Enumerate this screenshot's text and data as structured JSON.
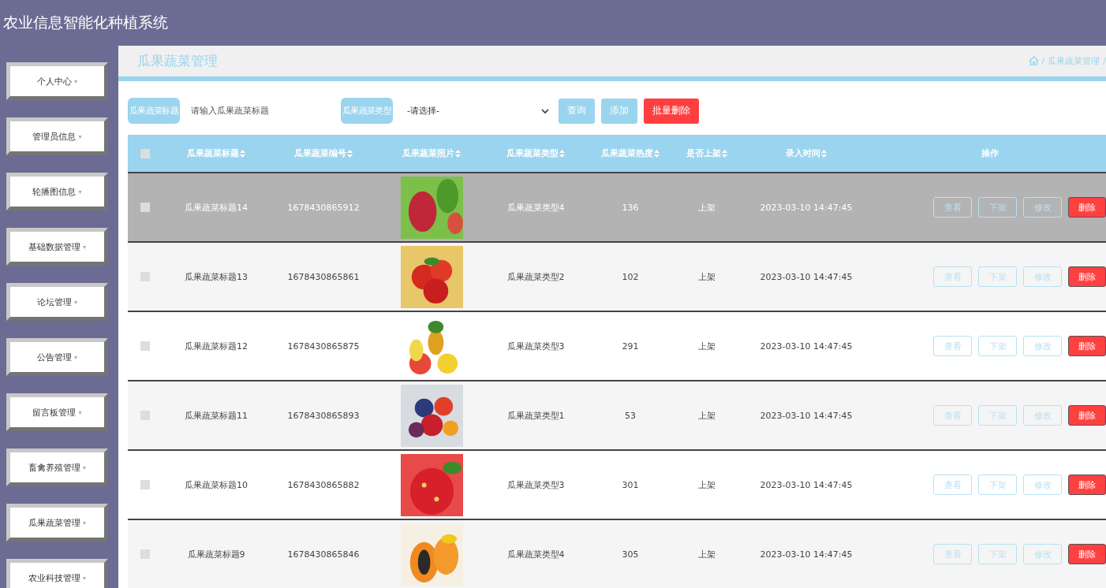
{
  "app_title": "农业信息智能化种植系统",
  "sidebar": {
    "items": [
      {
        "label": "个人中心",
        "caret": "▾"
      },
      {
        "label": "管理员信息",
        "caret": "▾"
      },
      {
        "label": "轮播图信息",
        "caret": "▾"
      },
      {
        "label": "基础数据管理",
        "caret": "▾"
      },
      {
        "label": "论坛管理",
        "caret": "▾"
      },
      {
        "label": "公告管理",
        "caret": "▾"
      },
      {
        "label": "留言板管理",
        "caret": "▾"
      },
      {
        "label": "畜禽养殖管理",
        "caret": "▾"
      },
      {
        "label": "瓜果蔬菜管理",
        "caret": "▾"
      },
      {
        "label": "农业科技管理",
        "caret": "▾"
      }
    ]
  },
  "page_title": "瓜果蔬菜管理",
  "breadcrumb": [
    "/",
    "瓜果蔬菜管理",
    "/"
  ],
  "filters": {
    "title_label": "瓜果蔬菜标题",
    "title_placeholder": "请输入瓜果蔬菜标题",
    "type_label": "瓜果蔬菜类型",
    "type_value": "-请选择-"
  },
  "actions": [
    {
      "label": "查询",
      "kind": "primary"
    },
    {
      "label": "添加",
      "kind": "primary"
    },
    {
      "label": "批量删除",
      "kind": "danger"
    }
  ],
  "table": {
    "columns": [
      {
        "label": "瓜果蔬菜标题",
        "sortable": true
      },
      {
        "label": "瓜果蔬菜编号",
        "sortable": true
      },
      {
        "label": "瓜果蔬菜照片",
        "sortable": true
      },
      {
        "label": "瓜果蔬菜类型",
        "sortable": true
      },
      {
        "label": "瓜果蔬菜热度",
        "sortable": true
      },
      {
        "label": "是否上架",
        "sortable": true
      },
      {
        "label": "录入时间",
        "sortable": true
      },
      {
        "label": "操作",
        "sortable": false
      }
    ],
    "all_checked": false,
    "rows": [
      {
        "checked": false,
        "highlighted": true,
        "title": "瓜果蔬菜标题14",
        "number": "1678430865912",
        "type": "瓜果蔬菜类型4",
        "heat": "136",
        "on_shelf": "上架",
        "time": "2023-03-10 14:47:45",
        "buttons": [
          "查看",
          "下架",
          "修改",
          "删除"
        ]
      },
      {
        "checked": false,
        "highlighted": false,
        "title": "瓜果蔬菜标题13",
        "number": "1678430865861",
        "type": "瓜果蔬菜类型2",
        "heat": "102",
        "on_shelf": "上架",
        "time": "2023-03-10 14:47:45",
        "buttons": [
          "查看",
          "下架",
          "修改",
          "删除"
        ]
      },
      {
        "checked": false,
        "highlighted": false,
        "title": "瓜果蔬菜标题12",
        "number": "1678430865875",
        "type": "瓜果蔬菜类型3",
        "heat": "291",
        "on_shelf": "上架",
        "time": "2023-03-10 14:47:45",
        "buttons": [
          "查看",
          "下架",
          "修改",
          "删除"
        ]
      },
      {
        "checked": false,
        "highlighted": false,
        "title": "瓜果蔬菜标题11",
        "number": "1678430865893",
        "type": "瓜果蔬菜类型1",
        "heat": "53",
        "on_shelf": "上架",
        "time": "2023-03-10 14:47:45",
        "buttons": [
          "查看",
          "下架",
          "修改",
          "删除"
        ]
      },
      {
        "checked": false,
        "highlighted": false,
        "title": "瓜果蔬菜标题10",
        "number": "1678430865882",
        "type": "瓜果蔬菜类型3",
        "heat": "301",
        "on_shelf": "上架",
        "time": "2023-03-10 14:47:45",
        "buttons": [
          "查看",
          "下架",
          "修改",
          "删除"
        ]
      },
      {
        "checked": false,
        "highlighted": false,
        "title": "瓜果蔬菜标题9",
        "number": "1678430865846",
        "type": "瓜果蔬菜类型4",
        "heat": "305",
        "on_shelf": "上架",
        "time": "2023-03-10 14:47:45",
        "buttons": [
          "查看",
          "下架",
          "修改",
          "删除"
        ]
      }
    ]
  }
}
